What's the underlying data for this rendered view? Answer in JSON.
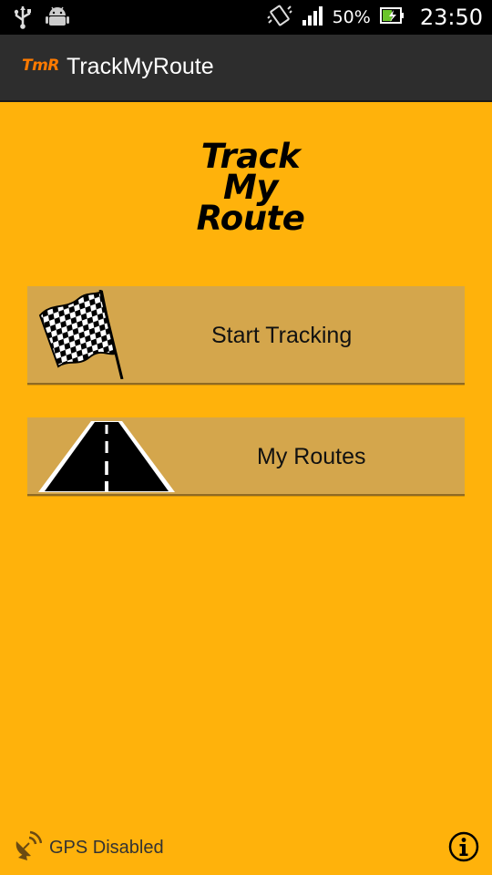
{
  "status_bar": {
    "icons_left": [
      "usb-icon",
      "android-debug-icon"
    ],
    "icons_right": [
      "vibrate-icon",
      "signal-icon",
      "battery-charging-icon"
    ],
    "battery_percent": "50%",
    "time": "23:50"
  },
  "action_bar": {
    "logo_text": "TmR",
    "title": "TrackMyRoute"
  },
  "logo": {
    "line1": "Track",
    "line2": "My",
    "line3": "Route"
  },
  "buttons": {
    "start_tracking": {
      "label": "Start Tracking",
      "icon": "checkered-flag-icon"
    },
    "my_routes": {
      "label": "My Routes",
      "icon": "road-icon"
    }
  },
  "footer": {
    "gps_status": "GPS Disabled",
    "gps_icon": "satellite-dish-icon",
    "info_icon": "info-icon"
  },
  "colors": {
    "background": "#FFB20B",
    "button_bg": "#D4A64C",
    "action_bar": "#2D2D2D",
    "logo_accent": "#FF7A00"
  }
}
